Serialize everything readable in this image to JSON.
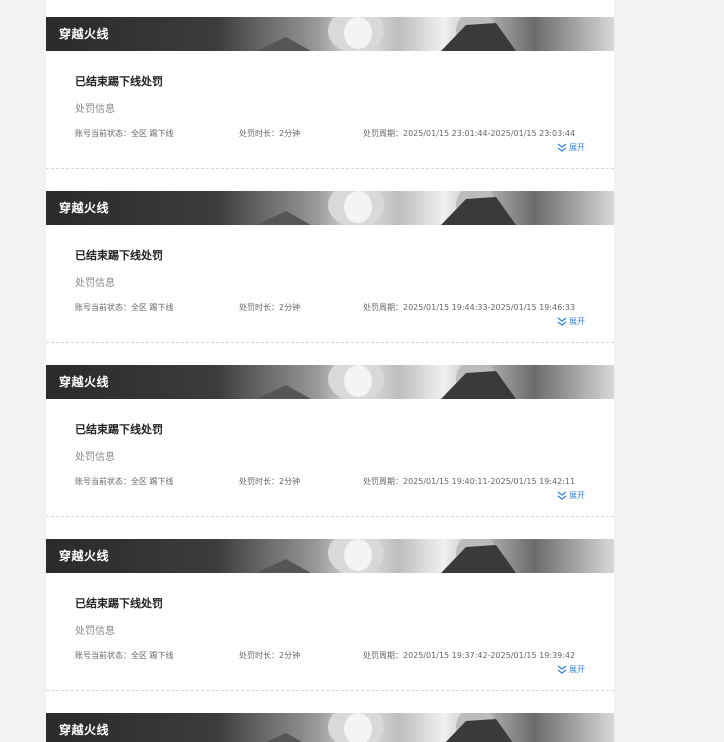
{
  "records": [
    {
      "game": "穿越火线",
      "status_title": "已结束踢下线处罚",
      "info_label": "处罚信息",
      "account_status": "账号当前状态：全区 踢下线",
      "duration": "处罚时长：2分钟",
      "period": "处罚周期：2025/01/15 23:01:44-2025/01/15 23:03:44",
      "expand_label": "展开"
    },
    {
      "game": "穿越火线",
      "status_title": "已结束踢下线处罚",
      "info_label": "处罚信息",
      "account_status": "账号当前状态：全区 踢下线",
      "duration": "处罚时长：2分钟",
      "period": "处罚周期：2025/01/15 19:44:33-2025/01/15 19:46:33",
      "expand_label": "展开"
    },
    {
      "game": "穿越火线",
      "status_title": "已结束踢下线处罚",
      "info_label": "处罚信息",
      "account_status": "账号当前状态：全区 踢下线",
      "duration": "处罚时长：2分钟",
      "period": "处罚周期：2025/01/15 19:40:11-2025/01/15 19:42:11",
      "expand_label": "展开"
    },
    {
      "game": "穿越火线",
      "status_title": "已结束踢下线处罚",
      "info_label": "处罚信息",
      "account_status": "账号当前状态：全区 踢下线",
      "duration": "处罚时长：2分钟",
      "period": "处罚周期：2025/01/15 19:37:42-2025/01/15 19:39:42",
      "expand_label": "展开"
    },
    {
      "game": "穿越火线"
    }
  ],
  "icons": {
    "expand": "double-chevron-down-icon"
  },
  "colors": {
    "link": "#3a86e0",
    "banner_text": "#ffffff",
    "page_bg": "#f2f2f2"
  }
}
